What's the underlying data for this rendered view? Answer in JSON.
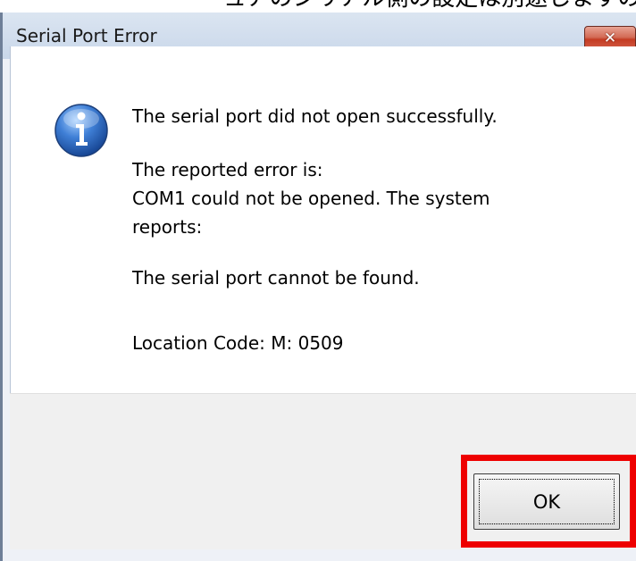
{
  "background_text": "ュアのシリアル側の設定は別途しますので下記はOKを",
  "dialog": {
    "title": "Serial Port Error",
    "close_button": {
      "label": "✕",
      "icon": "close-icon",
      "color": "#c43b22"
    },
    "icon": "info-icon",
    "messages": [
      "The serial port did not open successfully.",
      "The reported error is:",
      "COM1 could not be opened.  The system",
      "reports:",
      "The serial port cannot be found.",
      "Location Code: M: 0509"
    ],
    "ok_button": {
      "label": "OK",
      "highlight_color": "#ee0000"
    }
  }
}
